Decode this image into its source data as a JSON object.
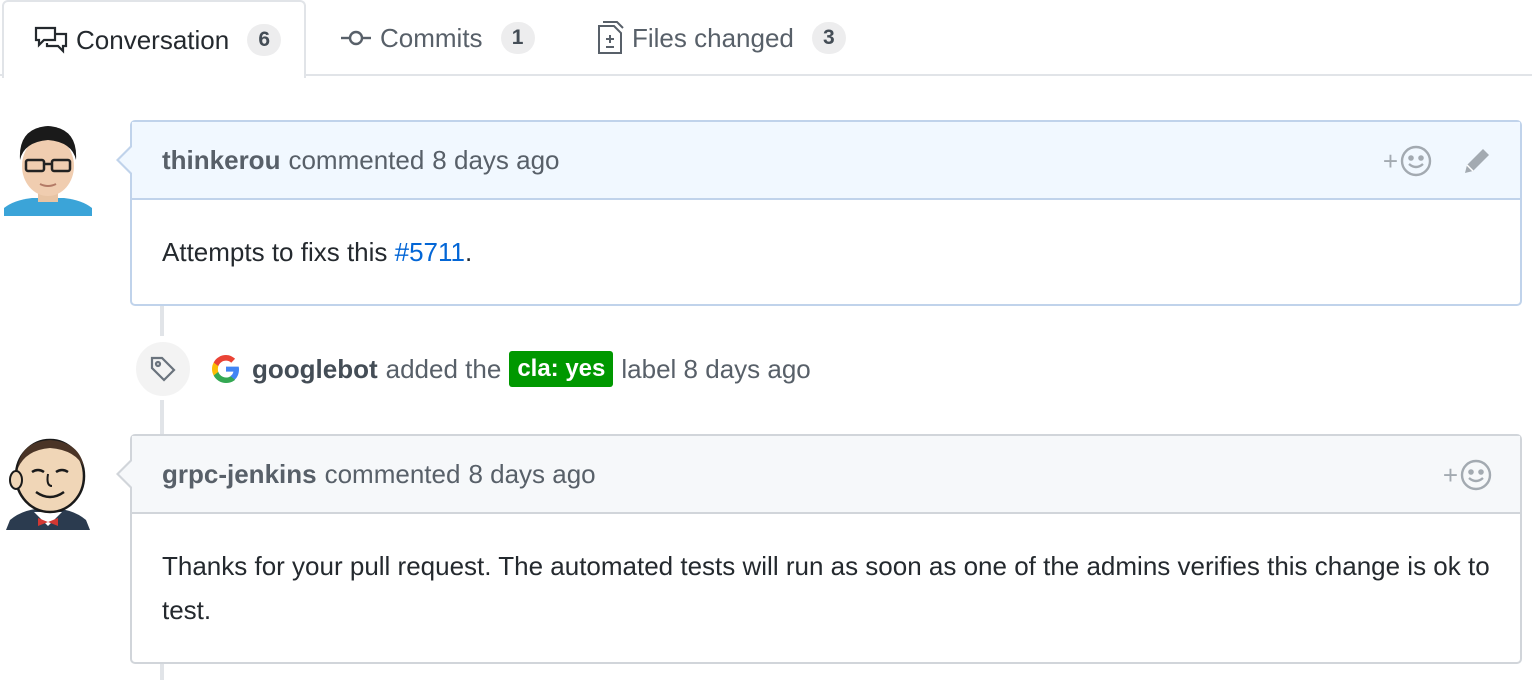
{
  "tabs": [
    {
      "label": "Conversation",
      "count": "6",
      "icon": "comment-discussion-icon",
      "selected": true
    },
    {
      "label": "Commits",
      "count": "1",
      "icon": "git-commit-icon",
      "selected": false
    },
    {
      "label": "Files changed",
      "count": "3",
      "icon": "file-diff-icon",
      "selected": false
    }
  ],
  "comments": [
    {
      "author": "thinkerou",
      "action": "commented",
      "time": "8 days ago",
      "body_prefix": "Attempts to fixs this ",
      "body_link": "#5711",
      "body_suffix": ".",
      "reaction_plus": "+",
      "avatar_icon": "user-avatar-icon"
    },
    {
      "author": "grpc-jenkins",
      "action": "commented",
      "time": "8 days ago",
      "body": "Thanks for your pull request. The automated tests will run as soon as one of the admins verifies this change is ok to test.",
      "reaction_plus": "+",
      "avatar_icon": "jenkins-avatar-icon"
    }
  ],
  "event": {
    "author": "googlebot",
    "text_before": "added the",
    "label": "cla: yes",
    "label_color": "#009800",
    "text_after": "label 8 days ago",
    "icon": "tag-icon",
    "author_icon": "google-logo-icon"
  },
  "colors": {
    "link": "#0366d6",
    "current_header_bg": "#f1f8ff",
    "other_header_bg": "#f6f8fa"
  }
}
